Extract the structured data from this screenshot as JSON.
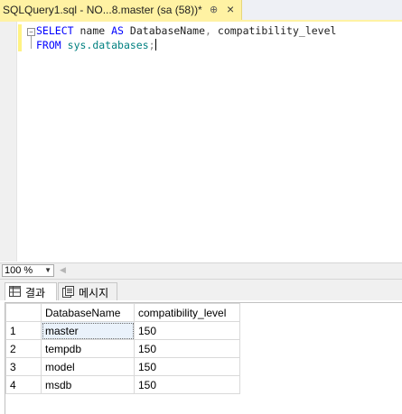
{
  "tab": {
    "title": "SQLQuery1.sql - NO...8.master (sa (58))*",
    "pin_glyph": "⊕",
    "close_glyph": "×"
  },
  "editor": {
    "line1": {
      "kw_select": "SELECT",
      "col": "name",
      "kw_as": "AS",
      "alias": "DatabaseName",
      "comma": ",",
      "col2": "compatibility_level"
    },
    "line2": {
      "kw_from": "FROM",
      "schema_obj": "sys.databases",
      "semicolon": ";"
    }
  },
  "zoom": {
    "value": "100 %"
  },
  "results_tabs": [
    {
      "label": "결과",
      "icon": "grid-icon"
    },
    {
      "label": "메시지",
      "icon": "messages-icon"
    }
  ],
  "grid": {
    "columns": [
      "DatabaseName",
      "compatibility_level"
    ],
    "rows": [
      {
        "num": "1",
        "name": "master",
        "level": "150"
      },
      {
        "num": "2",
        "name": "tempdb",
        "level": "150"
      },
      {
        "num": "3",
        "name": "model",
        "level": "150"
      },
      {
        "num": "4",
        "name": "msdb",
        "level": "150"
      }
    ]
  },
  "colors": {
    "tab_active": "#fff2a3",
    "keyword": "#0000ff",
    "system_object": "#008080",
    "punctuation": "#808080"
  }
}
